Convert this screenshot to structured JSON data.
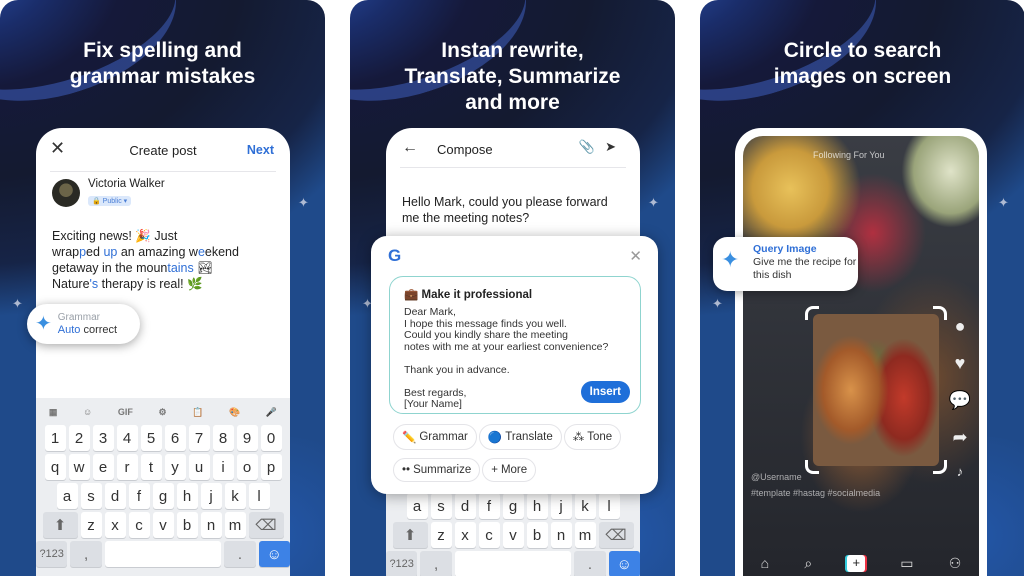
{
  "panels": [
    {
      "headline": [
        "Fix spelling and",
        "grammar mistakes"
      ],
      "phone": {
        "header": {
          "close_icon": "✕",
          "title": "Create post",
          "next_label": "Next"
        },
        "user": {
          "name": "Victoria Walker",
          "audience": "🔒 Public ▾"
        },
        "post_lines": [
          [
            {
              "t": "Exciting news! 🎉 Just"
            }
          ],
          [
            {
              "t": "wrap"
            },
            {
              "t": "p",
              "hl": true
            },
            {
              "t": "ed "
            },
            {
              "t": "up",
              "hl": true
            },
            {
              "t": " an amazing w"
            },
            {
              "t": "e",
              "hl": true
            },
            {
              "t": "ekend"
            }
          ],
          [
            {
              "t": "getaway in the moun"
            },
            {
              "t": "tains",
              "hl": true
            },
            {
              "t": " 🏞"
            }
          ],
          [
            {
              "t": "Nature"
            },
            {
              "t": "'s",
              "hl": true
            },
            {
              "t": " therapy is real! 🌿"
            }
          ]
        ],
        "badge": {
          "line1": "Grammar",
          "line2_accent": "Auto",
          "line2_rest": " correct"
        }
      }
    },
    {
      "headline": [
        "Instan rewrite,",
        "Translate, Summarize",
        "and more"
      ],
      "phone": {
        "header": {
          "back_icon": "←",
          "title": "Compose",
          "attach_icon": "📎",
          "send_icon": "➤"
        },
        "message": "Hello Mark, could you please forward me the meeting notes?"
      },
      "assistant": {
        "logo": "G",
        "close_icon": "✕",
        "suggestion_title": "💼 Make it professional",
        "suggestion_body": "Dear Mark,\nI hope this message finds you well.\nCould you kindly share the meeting\nnotes with me at your earliest convenience?\n\nThank you in advance.\n\nBest regards,\n[Your Name]",
        "insert_label": "Insert",
        "chips": [
          {
            "icon": "✏️",
            "label": "Grammar"
          },
          {
            "icon": "🔵",
            "label": "Translate"
          },
          {
            "icon": "⁂",
            "label": "Tone"
          },
          {
            "icon": "••",
            "label": "Summarize"
          },
          {
            "icon": "+",
            "label": "More"
          }
        ]
      }
    },
    {
      "headline": [
        "Circle to search",
        "images on screen"
      ],
      "phone": {
        "feed_tabs": "Following  For You",
        "username": "@Username",
        "hashtags": "#template #hastag #socialmedia",
        "rail_icons": [
          "avatar",
          "heart",
          "comment",
          "share"
        ],
        "nav_icons": [
          "⌂",
          "⌕",
          "+",
          "▭",
          "⚇"
        ]
      },
      "query": {
        "title": "Query Image",
        "prompt": "Give me the recipe for this dish"
      }
    }
  ],
  "keyboard": {
    "toolbar": [
      "▦",
      "☺",
      "GIF",
      "⚙",
      "📋",
      "🎨",
      "🎤"
    ],
    "row_numbers": [
      "1",
      "2",
      "3",
      "4",
      "5",
      "6",
      "7",
      "8",
      "9",
      "0"
    ],
    "row_top": [
      "q",
      "w",
      "e",
      "r",
      "t",
      "y",
      "u",
      "i",
      "o",
      "p"
    ],
    "row_mid": [
      "a",
      "s",
      "d",
      "f",
      "g",
      "h",
      "j",
      "k",
      "l"
    ],
    "row_bottom": [
      "z",
      "x",
      "c",
      "v",
      "b",
      "n",
      "m"
    ],
    "shift": "⬆",
    "backspace": "⌫",
    "symbols": "?123",
    "comma": ",",
    "period": ".",
    "emoji": "☺"
  },
  "sparkle": "✦"
}
